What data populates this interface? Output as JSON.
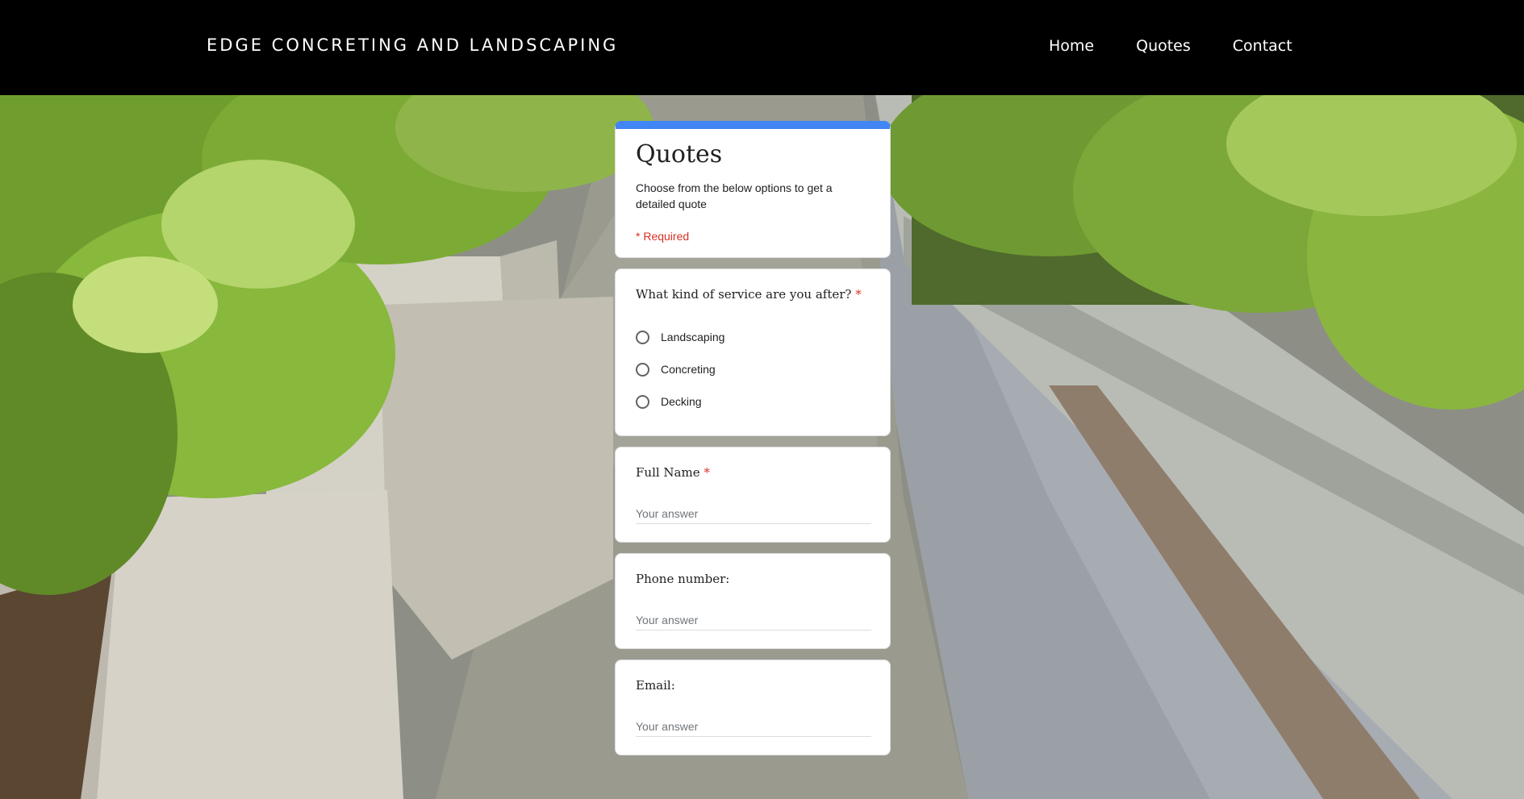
{
  "header": {
    "brand": "EDGE CONCRETING AND LANDSCAPING",
    "nav": [
      "Home",
      "Quotes",
      "Contact"
    ]
  },
  "form": {
    "title": "Quotes",
    "description": "Choose from the below options to get a detailed quote",
    "required_note": "* Required",
    "accent_color": "#4285f4",
    "required_color": "#d93025",
    "questions": [
      {
        "label": "What kind of service are you after?",
        "required": "*",
        "options": [
          "Landscaping",
          "Concreting",
          "Decking"
        ]
      },
      {
        "label": "Full Name",
        "required": "*",
        "placeholder": "Your answer"
      },
      {
        "label": "Phone number:",
        "placeholder": "Your answer"
      },
      {
        "label": "Email:",
        "placeholder": "Your answer"
      }
    ]
  }
}
